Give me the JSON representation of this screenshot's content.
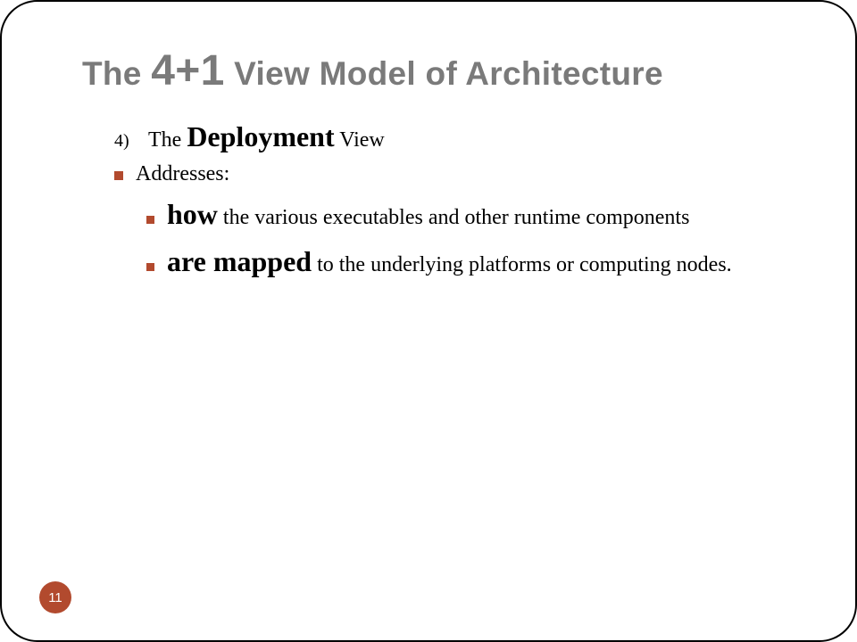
{
  "title": {
    "pre": "The ",
    "accent": "4+1",
    "post": " View Model of Architecture"
  },
  "list": {
    "item1": {
      "num": "4)",
      "pre": "The ",
      "strong": "Deployment",
      "post": " View"
    },
    "item2": {
      "text": "Addresses:"
    },
    "item3": {
      "strong": "how",
      "post": " the various executables and other runtime components"
    },
    "item4": {
      "strong": "are mapped",
      "post": " to the underlying platforms or computing nodes."
    }
  },
  "slideNumber": "11"
}
